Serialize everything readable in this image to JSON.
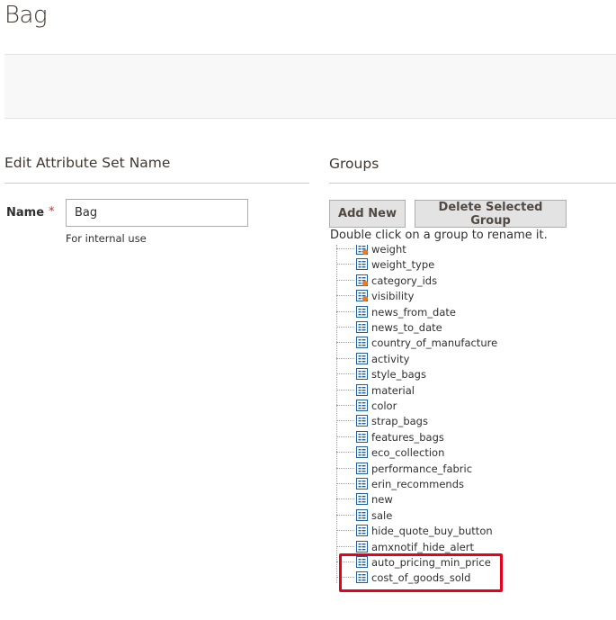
{
  "page": {
    "title": "Bag"
  },
  "edit_section": {
    "title": "Edit Attribute Set Name",
    "name_label": "Name",
    "required_mark": "*",
    "name_value": "Bag",
    "note": "For internal use"
  },
  "groups_section": {
    "title": "Groups",
    "add_new_label": "Add New",
    "delete_label": "Delete Selected Group",
    "hint": "Double click on a group to rename it."
  },
  "tree": {
    "nodes": [
      {
        "label": "weight",
        "icon": "system-attribute-icon"
      },
      {
        "label": "weight_type",
        "icon": "attribute-icon"
      },
      {
        "label": "category_ids",
        "icon": "system-attribute-icon"
      },
      {
        "label": "visibility",
        "icon": "system-attribute-icon"
      },
      {
        "label": "news_from_date",
        "icon": "attribute-icon"
      },
      {
        "label": "news_to_date",
        "icon": "attribute-icon"
      },
      {
        "label": "country_of_manufacture",
        "icon": "attribute-icon"
      },
      {
        "label": "activity",
        "icon": "attribute-icon"
      },
      {
        "label": "style_bags",
        "icon": "attribute-icon"
      },
      {
        "label": "material",
        "icon": "attribute-icon"
      },
      {
        "label": "color",
        "icon": "attribute-icon"
      },
      {
        "label": "strap_bags",
        "icon": "attribute-icon"
      },
      {
        "label": "features_bags",
        "icon": "attribute-icon"
      },
      {
        "label": "eco_collection",
        "icon": "attribute-icon"
      },
      {
        "label": "performance_fabric",
        "icon": "attribute-icon"
      },
      {
        "label": "erin_recommends",
        "icon": "attribute-icon"
      },
      {
        "label": "new",
        "icon": "attribute-icon"
      },
      {
        "label": "sale",
        "icon": "attribute-icon"
      },
      {
        "label": "hide_quote_buy_button",
        "icon": "attribute-icon"
      },
      {
        "label": "amxnotif_hide_alert",
        "icon": "attribute-icon"
      },
      {
        "label": "auto_pricing_min_price",
        "icon": "attribute-icon"
      },
      {
        "label": "cost_of_goods_sold",
        "icon": "attribute-icon"
      }
    ]
  },
  "colors": {
    "highlight": "#e8001c",
    "required": "#e22626",
    "icon_blue": "#1f5f9a",
    "system_dot": "#f07a1a"
  }
}
